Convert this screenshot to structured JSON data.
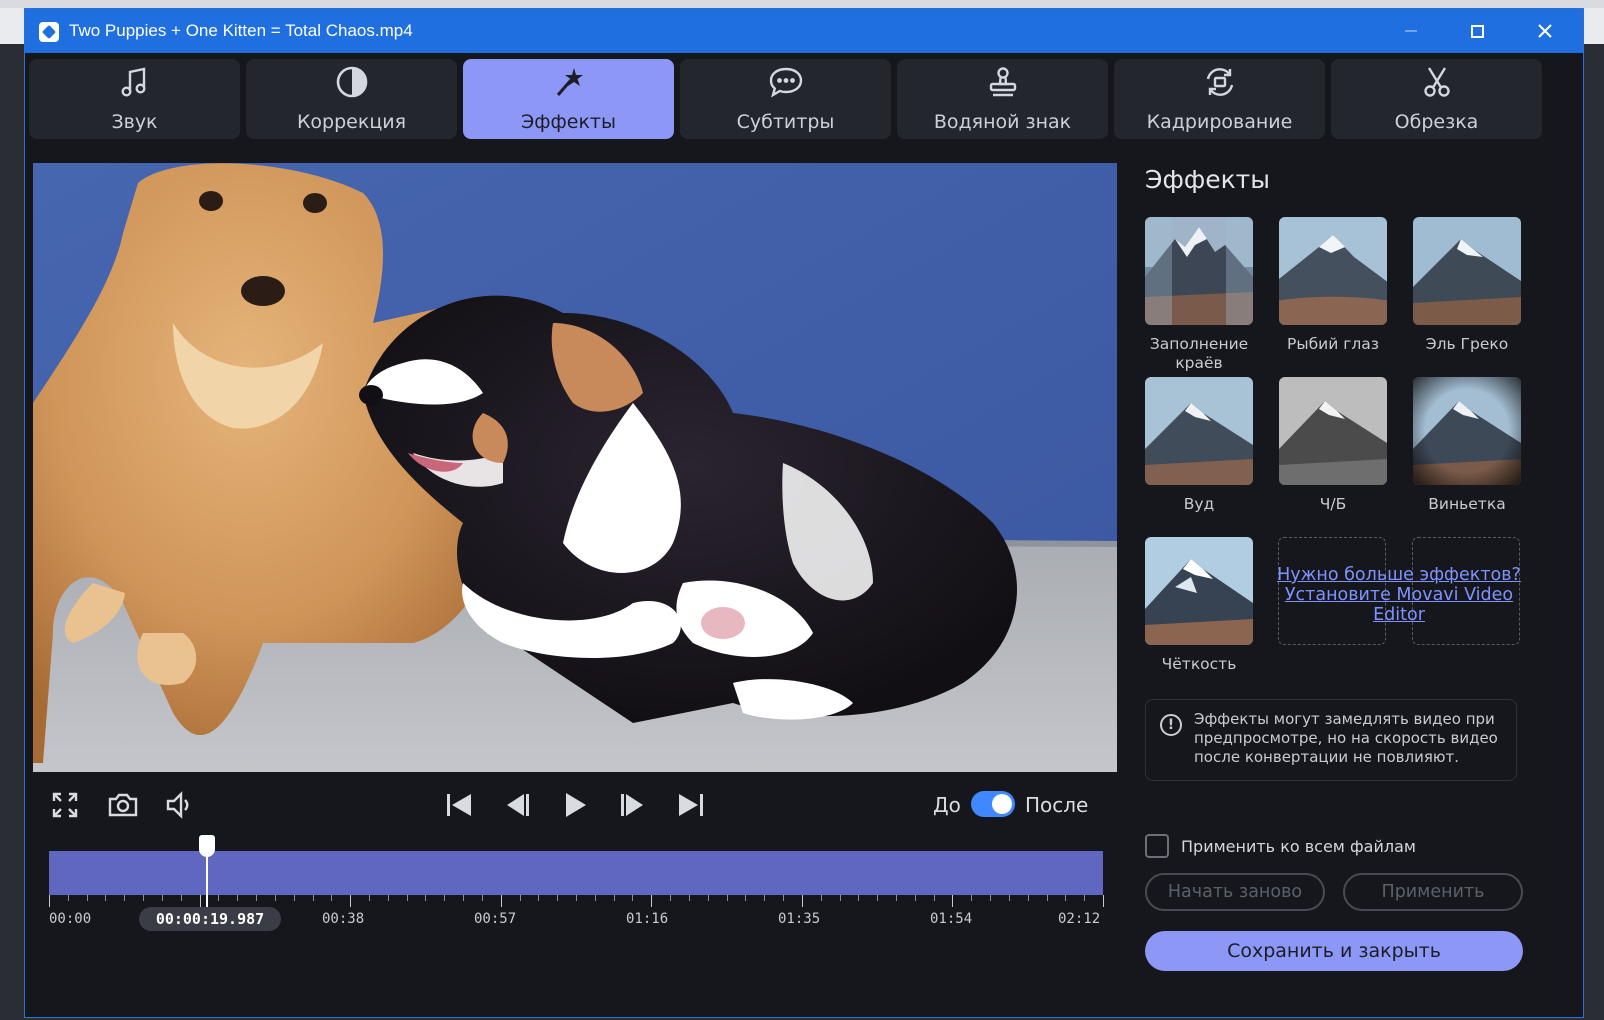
{
  "window": {
    "title": "Two Puppies + One Kitten = Total Chaos.mp4"
  },
  "tabs": [
    {
      "label": "Звук",
      "icon": "music-note-icon"
    },
    {
      "label": "Коррекция",
      "icon": "contrast-icon"
    },
    {
      "label": "Эффекты",
      "icon": "magic-wand-icon",
      "active": true
    },
    {
      "label": "Субтитры",
      "icon": "speech-bubble-icon"
    },
    {
      "label": "Водяной знак",
      "icon": "stamp-icon"
    },
    {
      "label": "Кадрирование",
      "icon": "rotate-crop-icon"
    },
    {
      "label": "Обрезка",
      "icon": "scissors-icon"
    }
  ],
  "player": {
    "before_label": "До",
    "after_label": "После",
    "before_after_toggle_on": true,
    "position_fraction": 0.15
  },
  "timeline": {
    "current": "00:00:19.987",
    "labels": [
      "00:00",
      "00:38",
      "00:57",
      "01:16",
      "01:35",
      "01:54",
      "02:12"
    ]
  },
  "effects_panel": {
    "title": "Эффекты",
    "effects": [
      {
        "label": "Заполнение краёв",
        "style": "tiled"
      },
      {
        "label": "Рыбий глаз",
        "style": "normal"
      },
      {
        "label": "Эль Греко",
        "style": "normal"
      },
      {
        "label": "Вуд",
        "style": "normal"
      },
      {
        "label": "Ч/Б",
        "style": "bw"
      },
      {
        "label": "Виньетка",
        "style": "vignette"
      },
      {
        "label": "Чёткость",
        "style": "sharp"
      }
    ],
    "more_link": "Нужно больше эффектов? Установите Movavi Video Editor",
    "notice": "Эффекты могут замедлять видео при предпросмотре, но на скорость видео после конвертации не повлияют.",
    "apply_all_label": "Применить ко всем файлам",
    "apply_all_checked": false,
    "reset_label": "Начать заново",
    "apply_label": "Применить",
    "save_label": "Сохранить и закрыть"
  },
  "colors": {
    "accent": "#8d97f6",
    "titlebar": "#1f6fe0",
    "timeline": "#6067c1",
    "link": "#7f93ff",
    "panel_bg": "#15171c"
  }
}
